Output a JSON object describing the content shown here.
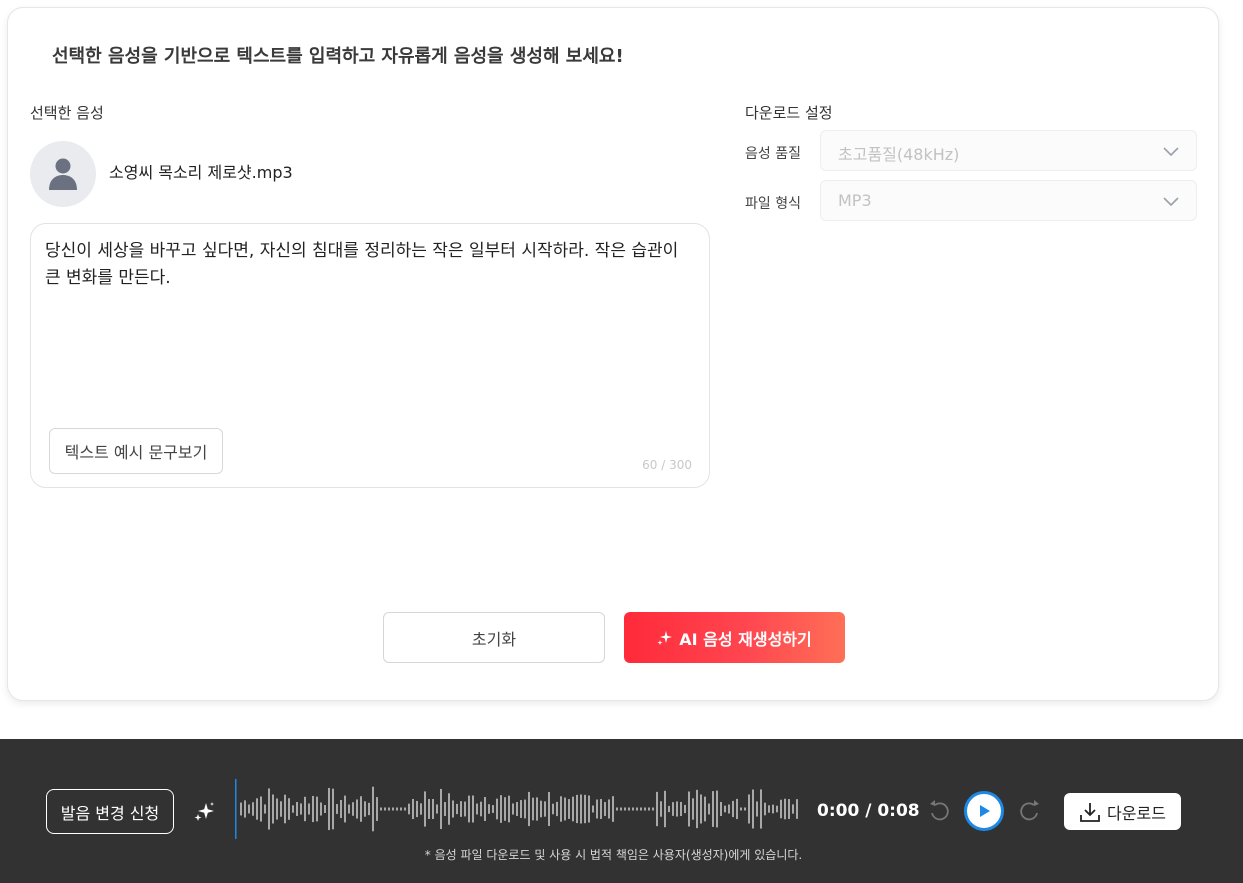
{
  "headline": "선택한 음성을 기반으로 텍스트를 입력하고 자유롭게 음성을 생성해 보세요!",
  "selected_voice": {
    "label": "선택한 음성",
    "file_name": "소영씨 목소리 제로샷.mp3"
  },
  "text_input": {
    "content": "당신이 세상을 바꾸고 싶다면, 자신의 침대를 정리하는 작은 일부터 시작하라. 작은 습관이 큰 변화를 만든다.",
    "example_button": "텍스트 예시 문구보기",
    "counter": "60 / 300"
  },
  "download_settings": {
    "label": "다운로드 설정",
    "quality_label": "음성 품질",
    "quality_value": "초고품질(48kHz)",
    "format_label": "파일 형식",
    "format_value": "MP3"
  },
  "actions": {
    "reset": "초기화",
    "regenerate": "AI 음성 재생성하기"
  },
  "player": {
    "pronunciation_button": "발음 변경 신청",
    "time": "0:00 / 0:08",
    "download_button": "다운로드",
    "disclaimer": "* 음성 파일 다운로드 및 사용 시 법적 책임은 사용자(생성자)에게 있습니다.",
    "progress_fraction": 0,
    "accent_color": "#1e88e5",
    "wave_color": "#a8a8a8"
  },
  "colors": {
    "primary": "#ff3b4a",
    "player_bg": "#323232"
  }
}
